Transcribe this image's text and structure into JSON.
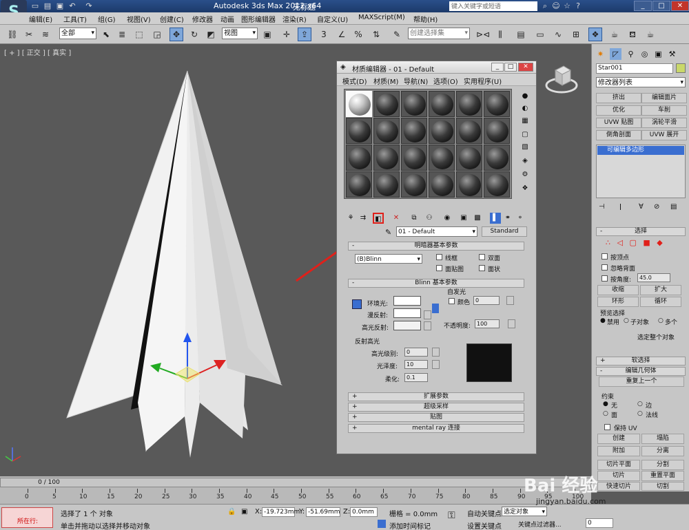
{
  "titlebar": {
    "app_title": "Autodesk 3ds Max  2012 x64",
    "doc_title": "无标题",
    "search_placeholder": "键入关键字或短语"
  },
  "menubar": [
    "编辑(E)",
    "工具(T)",
    "组(G)",
    "视图(V)",
    "创建(C)",
    "修改器",
    "动画",
    "图形编辑器",
    "渲染(R)",
    "自定义(U)",
    "MAXScript(M)",
    "帮助(H)"
  ],
  "toolbar": {
    "selection_filter": "全部",
    "ref_coord": "视图",
    "named_selection_placeholder": "创建选择集",
    "percent_label": "%"
  },
  "viewport": {
    "label": "[ + ] [ 正交 ] [ 真实 ]"
  },
  "material_editor": {
    "title": "材质编辑器 - 01 - Default",
    "menu": [
      "模式(D)",
      "材质(M)",
      "导航(N)",
      "选项(O)",
      "实用程序(U)"
    ],
    "material_name": "01 - Default",
    "material_type": "Standard",
    "shader_rollout": {
      "title": "明暗器基本参数",
      "shader": "(B)Blinn",
      "checks": [
        "线框",
        "双面",
        "面贴图",
        "面状"
      ]
    },
    "blinn_rollout": {
      "title": "Blinn 基本参数",
      "self_illum_title": "自发光",
      "ambient": "环境光:",
      "diffuse": "漫反射:",
      "specular": "高光反射:",
      "color_label": "颜色",
      "self_illum_value": "0",
      "opacity_label": "不透明度:",
      "opacity_value": "100",
      "spec_title": "反射高光",
      "spec_level_label": "高光级别:",
      "spec_level_value": "0",
      "gloss_label": "光泽度:",
      "gloss_value": "10",
      "soften_label": "柔化:",
      "soften_value": "0.1"
    },
    "collapsed_rollouts": [
      "扩展参数",
      "超级采样",
      "贴图",
      "mental ray 连接"
    ]
  },
  "command_panel": {
    "object_name": "Star001",
    "modifier_list": "修改器列表",
    "modifier_buttons": [
      "挤出",
      "编辑面片",
      "优化",
      "车削",
      "UVW 贴图",
      "涡轮平滑",
      "倒角剖面",
      "UVW 展开"
    ],
    "stack_item": "可编辑多边形",
    "selection_title": "选择",
    "selection_checks": [
      "按顶点",
      "忽略背面",
      "按角度:"
    ],
    "angle_value": "45.0",
    "sel_buttons": [
      "收缩",
      "扩大",
      "环形",
      "循环"
    ],
    "preview_title": "预览选择",
    "preview_opts": [
      "禁用",
      "子对象",
      "多个"
    ],
    "select_whole": "选定整个对象",
    "soft_sel_title": "软选择",
    "edit_geo_title": "编辑几何体",
    "repeat_last": "重复上一个",
    "constraints_title": "约束",
    "constraints": [
      "无",
      "边",
      "面",
      "法线"
    ],
    "preserve_uv": "保持 UV",
    "geo_buttons": [
      "创建",
      "塌陷",
      "附加",
      "分离",
      "切片平面",
      "分割",
      "切片",
      "重置平面",
      "快速切片",
      "切割"
    ]
  },
  "timeline": {
    "frame_display": "0 / 100",
    "ticks": [
      "0",
      "5",
      "10",
      "15",
      "20",
      "25",
      "30",
      "35",
      "40",
      "45",
      "50",
      "55",
      "60",
      "65",
      "70",
      "75",
      "80",
      "85",
      "90",
      "95",
      "100"
    ]
  },
  "statusbar": {
    "running": "所在行:",
    "selected": "选择了 1 个 对象",
    "prompt": "单击并拖动以选择并移动对象",
    "x_label": "X:",
    "x_value": "-19.723mm",
    "y_label": "Y:",
    "y_value": "-51.69mm",
    "z_label": "Z:",
    "z_value": "0.0mm",
    "grid": "栅格 = 0.0mm",
    "add_time_tag": "添加时间标记",
    "auto_key": "自动关键点",
    "set_key": "设置关键点",
    "selected_filter": "选定对象",
    "key_filters": "关键点过滤器...",
    "frame_value": "0"
  },
  "watermark": {
    "text": "Bai 经验",
    "url": "jingyan.baidu.com"
  },
  "colors": {
    "accent": "#2c5a9a",
    "highlight_red": "#e0201a",
    "viewport_bg": "#595959"
  }
}
